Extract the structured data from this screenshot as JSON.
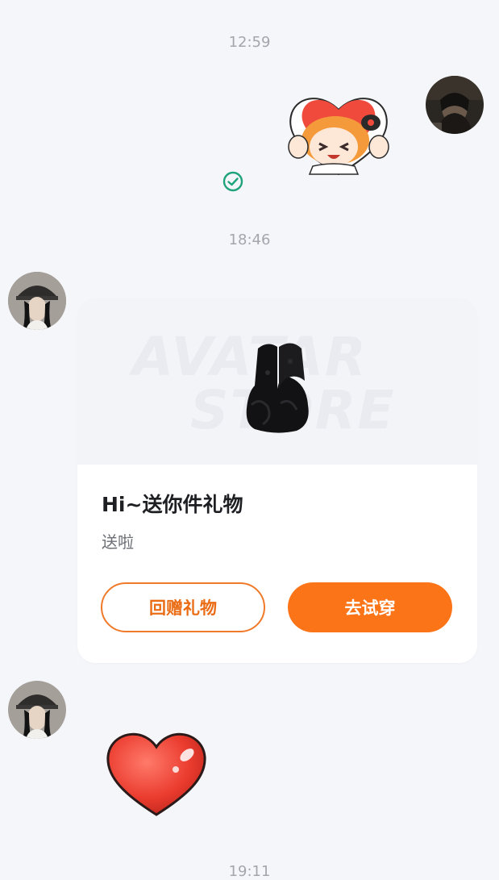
{
  "timestamps": [
    "12:59",
    "18:46",
    "19:11"
  ],
  "card": {
    "watermark_line1": "AVATAR",
    "watermark_line2": "STORE",
    "title": "Hi~送你件礼物",
    "subtitle": "送啦",
    "button_return_gift": "回赠礼物",
    "button_try_on": "去试穿"
  },
  "colors": {
    "accent": "#fb7417",
    "read_check": "#1fa37a",
    "background": "#f5f6fa"
  },
  "icons": {
    "sent_sticker": "anime-girl-heart-sticker-icon",
    "read_status": "check-circle-icon",
    "gift_item": "black-fur-mittens-icon",
    "received_sticker": "red-heart-sticker-icon"
  }
}
